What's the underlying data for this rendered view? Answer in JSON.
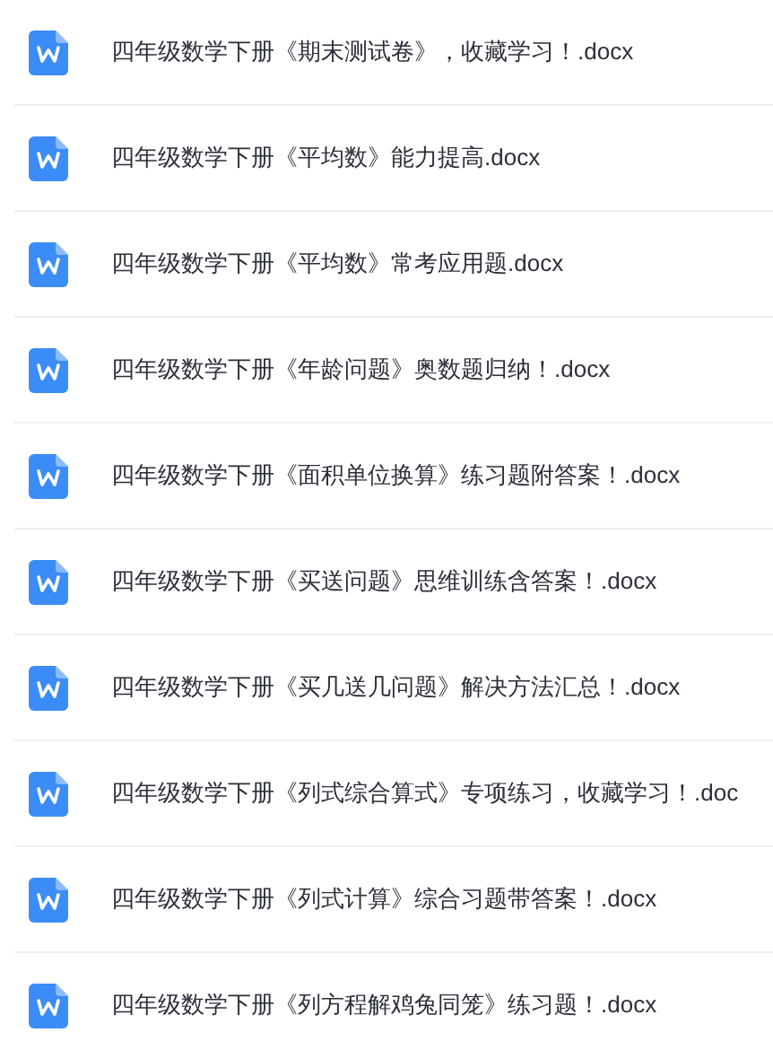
{
  "files": [
    {
      "name": "四年级数学下册《期末测试卷》，收藏学习！.docx"
    },
    {
      "name": "四年级数学下册《平均数》能力提高.docx"
    },
    {
      "name": "四年级数学下册《平均数》常考应用题.docx"
    },
    {
      "name": "四年级数学下册《年龄问题》奥数题归纳！.docx"
    },
    {
      "name": "四年级数学下册《面积单位换算》练习题附答案！.docx"
    },
    {
      "name": "四年级数学下册《买送问题》思维训练含答案！.docx"
    },
    {
      "name": "四年级数学下册《买几送几问题》解决方法汇总！.docx"
    },
    {
      "name": "四年级数学下册《列式综合算式》专项练习，收藏学习！.doc"
    },
    {
      "name": "四年级数学下册《列式计算》综合习题带答案！.docx"
    },
    {
      "name": "四年级数学下册《列方程解鸡兔同笼》练习题！.docx"
    }
  ]
}
